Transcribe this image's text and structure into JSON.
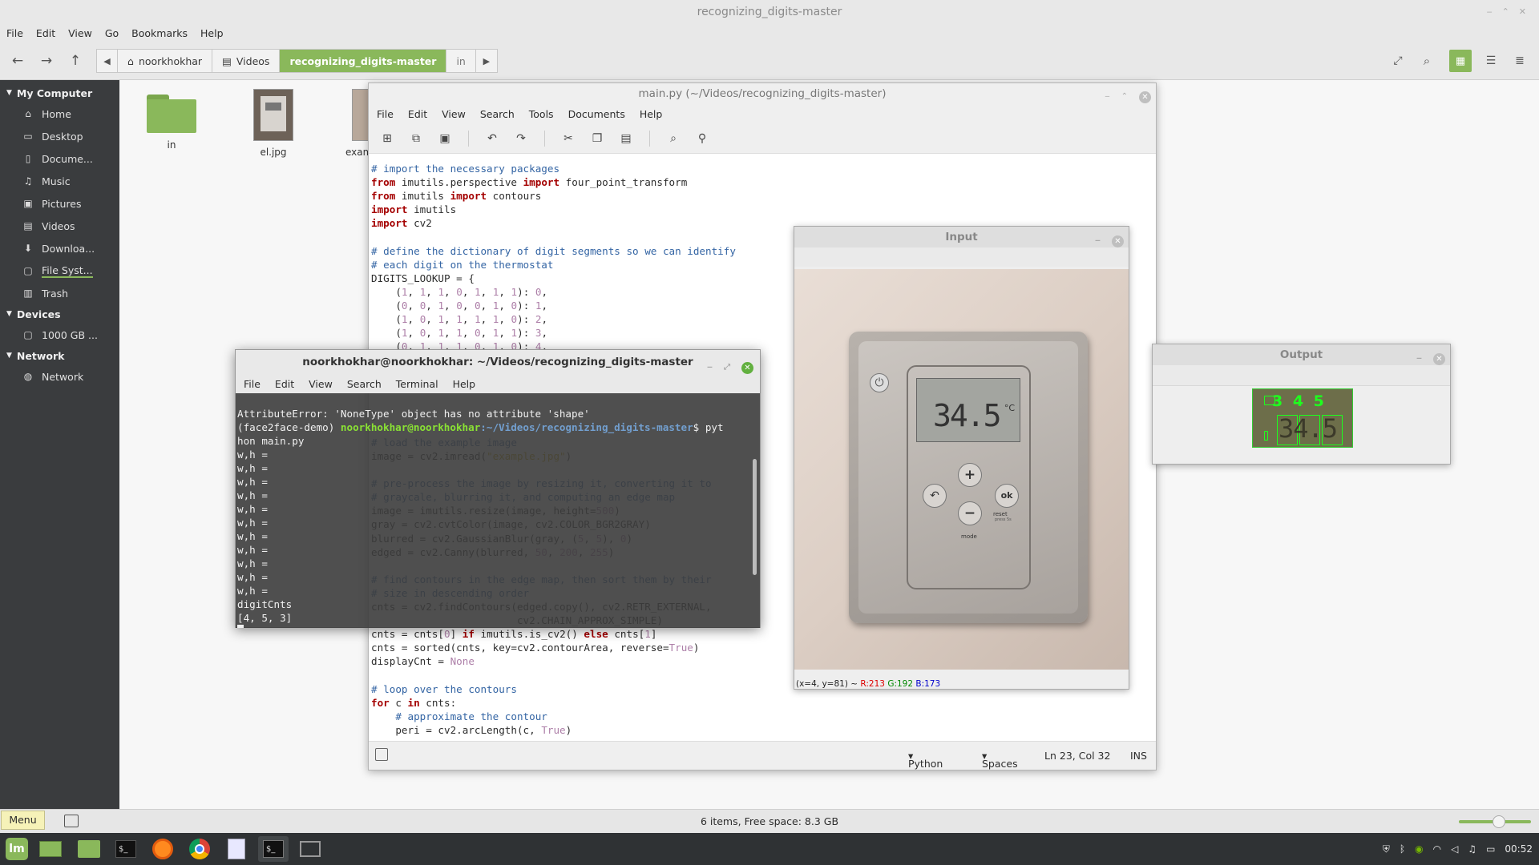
{
  "file_manager": {
    "title": "recognizing_digits-master",
    "menu": [
      "File",
      "Edit",
      "View",
      "Go",
      "Bookmarks",
      "Help"
    ],
    "breadcrumbs": [
      "noorkhokhar",
      "Videos",
      "recognizing_digits-master",
      "in"
    ],
    "sidebar": {
      "my_computer": "My Computer",
      "places": [
        "Home",
        "Desktop",
        "Docume...",
        "Music",
        "Pictures",
        "Videos",
        "Downloa...",
        "File Syst...",
        "Trash"
      ],
      "devices_header": "Devices",
      "devices": [
        "1000 GB ..."
      ],
      "network_header": "Network",
      "network": [
        "Network"
      ]
    },
    "files": [
      "in",
      "el.jpg",
      "exam"
    ],
    "status": "6 items, Free space: 8.3 GB",
    "accent": "#8ab85b"
  },
  "editor": {
    "title": "main.py (~/Videos/recognizing_digits-master)",
    "menu": [
      "File",
      "Edit",
      "View",
      "Search",
      "Tools",
      "Documents",
      "Help"
    ],
    "code": [
      "# import the necessary packages",
      "from imutils.perspective import four_point_transform",
      "from imutils import contours",
      "import imutils",
      "import cv2",
      "",
      "# define the dictionary of digit segments so we can identify",
      "# each digit on the thermostat",
      "DIGITS_LOOKUP = {",
      "    (1, 1, 1, 0, 1, 1, 1): 0,",
      "    (0, 0, 1, 0, 0, 1, 0): 1,",
      "    (1, 0, 1, 1, 1, 1, 0): 2,",
      "    (1, 0, 1, 1, 0, 1, 1): 3,",
      "    (0, 1, 1, 1, 0, 1, 0): 4,",
      "",
      "",
      "",
      "",
      "}",
      "",
      "# load the example image",
      "image = cv2.imread(\"example.jpg\")",
      "",
      "# pre-process the image by resizing it, converting it to",
      "# graycale, blurring it, and computing an edge map",
      "image = imutils.resize(image, height=500)",
      "gray = cv2.cvtColor(image, cv2.COLOR_BGR2GRAY)",
      "blurred = cv2.GaussianBlur(gray, (5, 5), 0)",
      "edged = cv2.Canny(blurred, 50, 200, 255)",
      "",
      "# find contours in the edge map, then sort them by their",
      "# size in descending order",
      "cnts = cv2.findContours(edged.copy(), cv2.RETR_EXTERNAL,",
      "                        cv2.CHAIN_APPROX_SIMPLE)",
      "cnts = cnts[0] if imutils.is_cv2() else cnts[1]",
      "cnts = sorted(cnts, key=cv2.contourArea, reverse=True)",
      "displayCnt = None",
      "",
      "# loop over the contours",
      "for c in cnts:",
      "    # approximate the contour",
      "    peri = cv2.arcLength(c, True)"
    ],
    "status": {
      "language": "Python",
      "indent": "Spaces",
      "position": "Ln 23, Col 32",
      "mode": "INS"
    }
  },
  "terminal": {
    "title": "noorkhokhar@noorkhokhar: ~/Videos/recognizing_digits-master",
    "menu": [
      "File",
      "Edit",
      "View",
      "Search",
      "Terminal",
      "Help"
    ],
    "error_line": "AttributeError: 'NoneType' object has no attribute 'shape'",
    "env": "(face2face-demo) ",
    "user": "noorkhokhar@noorkhokhar",
    "path": ":~/Videos/recognizing_digits-master",
    "command_a": "$ pyt",
    "command_b": "hon main.py",
    "wh_lines": [
      "w,h =",
      "w,h =",
      "w,h =",
      "w,h =",
      "w,h =",
      "w,h =",
      "w,h =",
      "w,h =",
      "w,h =",
      "w,h =",
      "w,h ="
    ],
    "result_label": "digitCnts",
    "result": "[4, 5, 3]"
  },
  "input_window": {
    "title": "Input",
    "display": "34.5",
    "unit": "°C",
    "button_plus": "+",
    "button_minus": "−",
    "button_ok": "ok",
    "label_reset": "reset",
    "label_reset_sub": "press 5s",
    "label_mode": "mode",
    "status_coords": "(x=4, y=81) ~ ",
    "status_r": "R:213",
    "status_g": "G:192",
    "status_b": "B:173"
  },
  "output_window": {
    "title": "Output",
    "digits": "3 4 5",
    "display": "34.5"
  },
  "taskbar": {
    "menu_label": "Menu",
    "clock": "00:52"
  }
}
